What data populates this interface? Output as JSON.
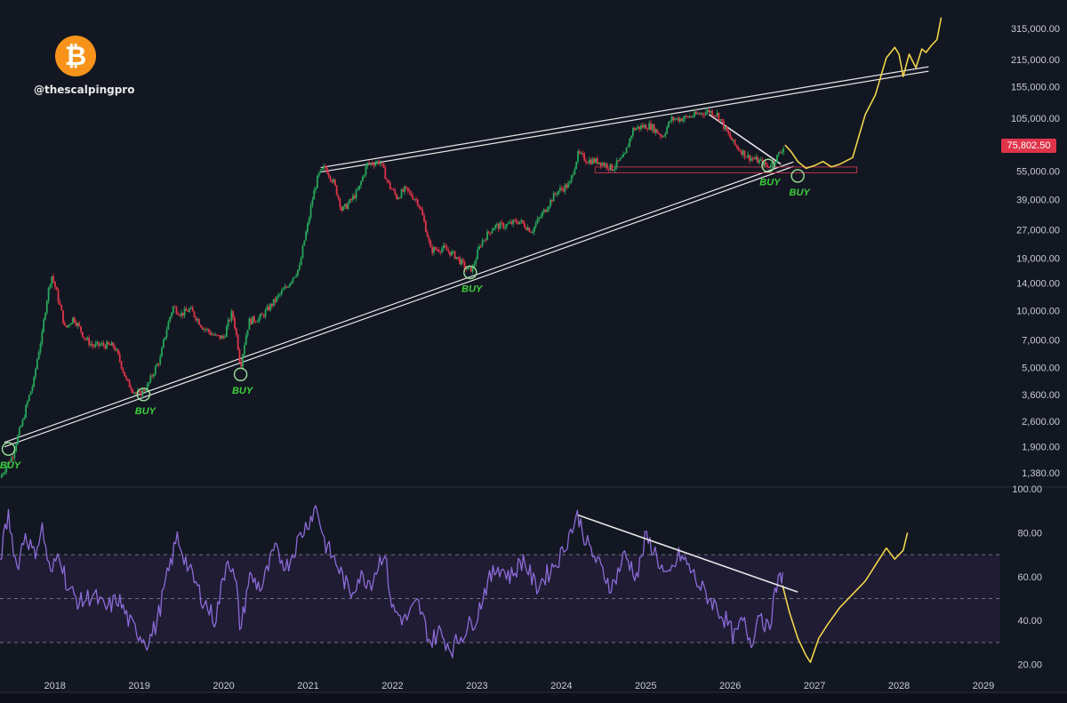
{
  "branding": {
    "logo_symbol": "₿",
    "handle": "@thescalpingpro",
    "logo_color": "#f7931a"
  },
  "colors": {
    "background": "#131722",
    "candle_up": "#26a65b",
    "candle_down": "#e0344a",
    "trendline": "#e6e6e6",
    "projection": "#f0d54a",
    "rsi_line": "#8c6bd6",
    "buy_label": "#3bd13b"
  },
  "current_price_label": "75,802.50",
  "buy_labels": [
    "BUY",
    "BUY",
    "BUY",
    "BUY",
    "BUY",
    "BUY"
  ],
  "chart_data": [
    {
      "type": "line",
      "title": "",
      "ylabel": "",
      "yscale": "log",
      "ylim": [
        1200,
        400000
      ],
      "y_ticks": [
        1380,
        1900,
        2600,
        3600,
        5000,
        7000,
        10000,
        14000,
        19000,
        27000,
        39000,
        55000,
        105000,
        155000,
        215000,
        315000
      ],
      "y_tick_labels": [
        "1,380.00",
        "1,900.00",
        "2,600.00",
        "3,600.00",
        "5,000.00",
        "7,000.00",
        "10,000.00",
        "14,000.00",
        "19,000.00",
        "27,000.00",
        "39,000.00",
        "55,000.00",
        "105,000.00",
        "155,000.00",
        "215,000.00",
        "315,000.00"
      ],
      "x_ticks": [
        2018,
        2019,
        2020,
        2021,
        2022,
        2023,
        2024,
        2025,
        2026,
        2027,
        2028,
        2029
      ],
      "x_tick_labels": [
        "2018",
        "2019",
        "2020",
        "2021",
        "2022",
        "2023",
        "2024",
        "2025",
        "2026",
        "2027",
        "2028",
        "2029"
      ],
      "xlim": [
        2017.35,
        2029.2
      ],
      "series": [
        {
          "x": [
            2017.35,
            2017.5,
            2017.62,
            2017.75,
            2017.85,
            2017.96,
            2018.05,
            2018.12,
            2018.22,
            2018.35,
            2018.45,
            2018.55,
            2018.7,
            2018.85,
            2018.95,
            2019.0,
            2019.1,
            2019.25,
            2019.4,
            2019.5,
            2019.6,
            2019.75,
            2019.9,
            2020.0,
            2020.1,
            2020.2,
            2020.3,
            2020.45,
            2020.6,
            2020.75,
            2020.9,
            2021.0,
            2021.05,
            2021.12,
            2021.2,
            2021.3,
            2021.4,
            2021.5,
            2021.6,
            2021.7,
            2021.85,
            2021.95,
            2022.05,
            2022.15,
            2022.3,
            2022.45,
            2022.6,
            2022.75,
            2022.88,
            2022.95,
            2023.05,
            2023.2,
            2023.35,
            2023.5,
            2023.65,
            2023.8,
            2023.95,
            2024.1,
            2024.2,
            2024.3,
            2024.45,
            2024.6,
            2024.75,
            2024.85,
            2024.95,
            2025.05,
            2025.2,
            2025.3,
            2025.45,
            2025.6,
            2025.75,
            2025.85,
            2025.95,
            2026.05,
            2026.2,
            2026.35,
            2026.45,
            2026.55,
            2026.65
          ],
          "values": [
            1300,
            1700,
            2600,
            4200,
            7500,
            15500,
            11000,
            8000,
            9200,
            7200,
            6500,
            6600,
            6500,
            4200,
            3700,
            3600,
            4000,
            5600,
            10500,
            9600,
            10200,
            8200,
            7300,
            7200,
            9800,
            5000,
            8800,
            9300,
            11200,
            13500,
            17000,
            29000,
            39000,
            52000,
            58000,
            48000,
            34000,
            38000,
            44000,
            60000,
            62000,
            47000,
            40000,
            44000,
            38000,
            21000,
            21500,
            19500,
            16500,
            16800,
            23000,
            28000,
            28500,
            30000,
            26500,
            34000,
            43000,
            47000,
            68000,
            63000,
            62000,
            57000,
            66000,
            92000,
            95000,
            96000,
            84000,
            104000,
            105000,
            110000,
            115000,
            110000,
            90000,
            76000,
            66000,
            62000,
            58000,
            65000,
            75800
          ]
        },
        {
          "name": "",
          "x": [
            2026.65,
            2026.72,
            2026.8,
            2026.9,
            2027.0,
            2027.1,
            2027.2,
            2027.3,
            2027.45,
            2027.6,
            2027.72,
            2027.85,
            2027.95,
            2028.0,
            2028.05,
            2028.12,
            2028.2,
            2028.27,
            2028.32,
            2028.38,
            2028.45,
            2028.5
          ],
          "values": [
            75800,
            70000,
            62000,
            57000,
            59000,
            62000,
            58000,
            60000,
            65000,
            110000,
            140000,
            220000,
            250000,
            230000,
            175000,
            230000,
            195000,
            245000,
            235000,
            255000,
            275000,
            360000
          ]
        }
      ],
      "trendlines": [
        {
          "from": [
            2017.4,
            1950
          ],
          "to": [
            2026.75,
            60000
          ]
        },
        {
          "from": [
            2021.15,
            56000
          ],
          "to": [
            2028.35,
            192000
          ]
        },
        {
          "from": [
            2025.75,
            110000
          ],
          "to": [
            2026.6,
            60000
          ]
        }
      ],
      "support_range": [
        54000,
        58000
      ],
      "buy_points": [
        {
          "x": 2017.45,
          "y": 1850
        },
        {
          "x": 2019.05,
          "y": 3600
        },
        {
          "x": 2020.2,
          "y": 4600
        },
        {
          "x": 2022.92,
          "y": 16000
        },
        {
          "x": 2026.45,
          "y": 59000
        },
        {
          "x": 2026.8,
          "y": 52000
        }
      ]
    },
    {
      "type": "line",
      "title": "",
      "ylabel": "",
      "ylim": [
        15,
        100
      ],
      "y_ticks": [
        20,
        40,
        60,
        80,
        100
      ],
      "y_tick_labels": [
        "20.00",
        "40.00",
        "60.00",
        "80.00",
        "100.00"
      ],
      "bands": [
        30,
        50,
        70
      ],
      "xlim": [
        2017.35,
        2029.2
      ],
      "series": [
        {
          "x": [
            2017.35,
            2017.45,
            2017.55,
            2017.65,
            2017.75,
            2017.85,
            2017.95,
            2018.05,
            2018.15,
            2018.3,
            2018.45,
            2018.6,
            2018.75,
            2018.9,
            2019.0,
            2019.1,
            2019.2,
            2019.3,
            2019.45,
            2019.6,
            2019.75,
            2019.9,
            2020.05,
            2020.15,
            2020.2,
            2020.3,
            2020.45,
            2020.6,
            2020.75,
            2020.9,
            2021.0,
            2021.1,
            2021.2,
            2021.35,
            2021.5,
            2021.6,
            2021.75,
            2021.9,
            2022.0,
            2022.15,
            2022.3,
            2022.45,
            2022.55,
            2022.7,
            2022.85,
            2023.0,
            2023.1,
            2023.25,
            2023.4,
            2023.55,
            2023.7,
            2023.85,
            2024.0,
            2024.1,
            2024.2,
            2024.3,
            2024.45,
            2024.6,
            2024.75,
            2024.9,
            2025.0,
            2025.1,
            2025.25,
            2025.4,
            2025.5,
            2025.65,
            2025.8,
            2025.95,
            2026.05,
            2026.15,
            2026.25,
            2026.35,
            2026.45,
            2026.55,
            2026.62
          ],
          "values": [
            68,
            88,
            64,
            80,
            70,
            82,
            60,
            72,
            55,
            48,
            52,
            45,
            50,
            38,
            34,
            30,
            38,
            55,
            78,
            62,
            50,
            40,
            70,
            55,
            35,
            60,
            55,
            72,
            65,
            78,
            85,
            92,
            75,
            65,
            52,
            60,
            58,
            72,
            45,
            40,
            48,
            30,
            35,
            27,
            35,
            42,
            55,
            65,
            60,
            68,
            55,
            62,
            70,
            80,
            88,
            75,
            65,
            55,
            70,
            60,
            78,
            72,
            58,
            70,
            65,
            55,
            48,
            40,
            32,
            40,
            30,
            45,
            35,
            55,
            62
          ]
        },
        {
          "name": "",
          "x": [
            2026.62,
            2026.7,
            2026.8,
            2026.9,
            2026.95,
            2027.05,
            2027.15,
            2027.3,
            2027.45,
            2027.6,
            2027.7,
            2027.8,
            2027.85,
            2027.95,
            2028.05,
            2028.1
          ],
          "values": [
            56,
            44,
            32,
            24,
            21,
            32,
            38,
            46,
            52,
            58,
            64,
            70,
            73,
            68,
            72,
            80
          ]
        }
      ],
      "trendlines": [
        {
          "from": [
            2024.2,
            88
          ],
          "to": [
            2026.8,
            53
          ]
        }
      ]
    }
  ]
}
